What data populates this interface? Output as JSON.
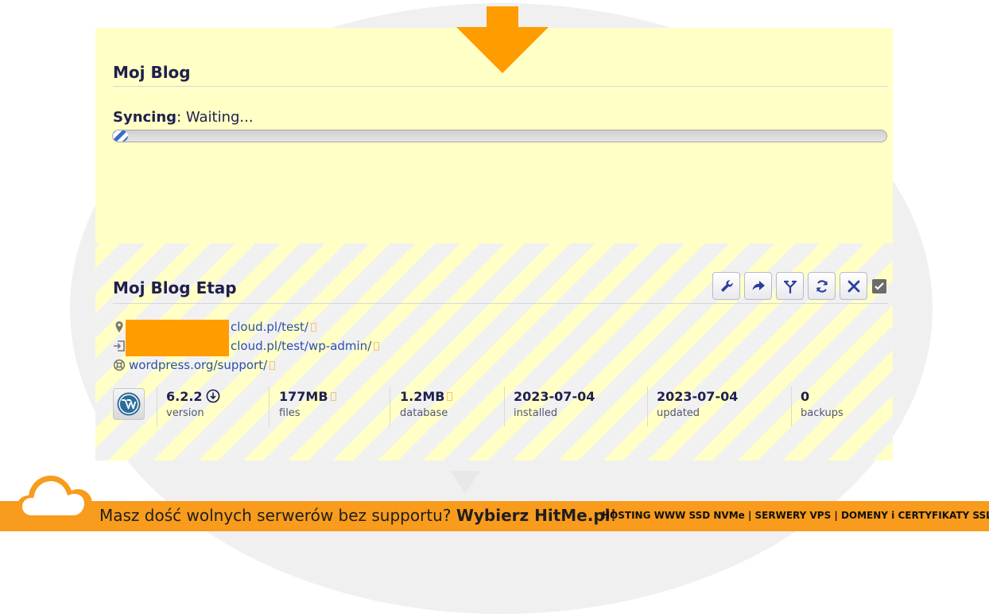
{
  "site1": {
    "title": "Moj Blog",
    "sync_label": "Syncing",
    "sync_status": ": Waiting...",
    "progress": 0.02
  },
  "site2": {
    "title": "Moj Blog Etap",
    "actions": [
      "wrench-icon",
      "share-icon",
      "fork-icon",
      "refresh-icon",
      "close-icon"
    ],
    "urls": {
      "site": "cloud.pl/test/",
      "admin": "cloud.pl/test/wp-admin/",
      "support": "wordpress.org/support/"
    },
    "stats": {
      "version": {
        "value": "6.2.2",
        "label": "version"
      },
      "files": {
        "value": "177MB",
        "label": "files"
      },
      "database": {
        "value": "1.2MB",
        "label": "database"
      },
      "installed": {
        "value": "2023-07-04",
        "label": "installed"
      },
      "updated": {
        "value": "2023-07-04",
        "label": "updated"
      },
      "backups": {
        "value": "0",
        "label": "backups"
      }
    }
  },
  "banner": {
    "text": "Masz dość wolnych serwerów bez supportu? ",
    "cta": "Wybierz HitMe.pl",
    "tail": "!",
    "links": "HOSTING WWW SSD NVMe | SERWERY VPS | DOMENY i CERTYFIKATY SSL"
  },
  "colors": {
    "accent": "#ff9d00",
    "card_bg": "#ffffc6",
    "title": "#1f1f4e",
    "link": "#2c4fa8",
    "banner": "#f99b1c"
  }
}
